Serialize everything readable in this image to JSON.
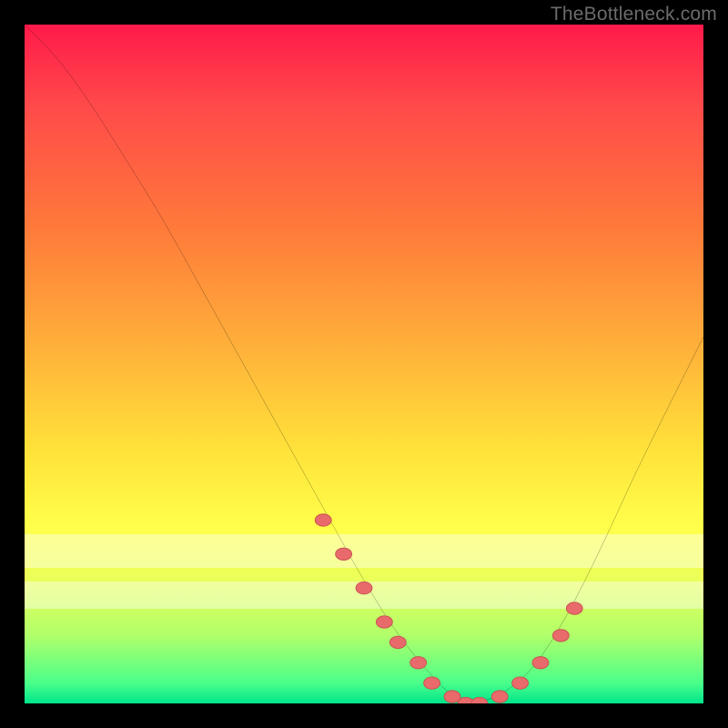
{
  "watermark": "TheBottleneck.com",
  "colors": {
    "curve": "#000000",
    "marker_fill": "#e86a6a",
    "marker_stroke": "#c74f4f",
    "pale_band": "rgba(255,255,255,0.42)"
  },
  "chart_data": {
    "type": "line",
    "title": "",
    "xlabel": "",
    "ylabel": "",
    "xlim": [
      0,
      100
    ],
    "ylim": [
      0,
      100
    ],
    "curve": {
      "x": [
        0,
        5,
        10,
        15,
        20,
        25,
        30,
        35,
        40,
        45,
        50,
        55,
        60,
        63,
        66,
        70,
        75,
        80,
        85,
        90,
        95,
        100
      ],
      "y": [
        100,
        95,
        88,
        80,
        72,
        63,
        54,
        45,
        36,
        27,
        18,
        10,
        4,
        1,
        0,
        1,
        5,
        13,
        23,
        34,
        44,
        54
      ]
    },
    "markers": {
      "x": [
        44,
        47,
        50,
        53,
        55,
        58,
        60,
        63,
        65,
        67,
        70,
        73,
        76,
        79,
        81
      ],
      "y": [
        27,
        22,
        17,
        12,
        9,
        6,
        3,
        1,
        0,
        0,
        1,
        3,
        6,
        10,
        14
      ]
    },
    "pale_bands_y": [
      [
        75,
        80
      ],
      [
        82,
        86
      ]
    ]
  }
}
